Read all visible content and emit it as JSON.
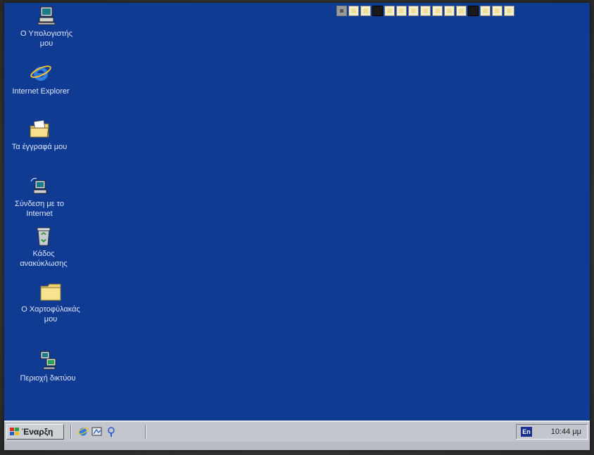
{
  "desktop": {
    "background": "#0f3b92",
    "icons": [
      {
        "label": "Ο Υπολογιστής\nμου",
        "icon": "my-computer-icon"
      },
      {
        "label": "Internet Explorer",
        "icon": "internet-explorer-icon"
      },
      {
        "label": "Τα έγγραφά μου",
        "icon": "my-documents-icon"
      },
      {
        "label": "Σύνδεση με το\nInternet",
        "icon": "connect-internet-icon"
      },
      {
        "label": "Κάδος\nανακύκλωσης",
        "icon": "recycle-bin-icon"
      },
      {
        "label": "Ο Χαρτοφύλακάς\nμου",
        "icon": "briefcase-folder-icon"
      },
      {
        "label": "Περιοχή δικτύου",
        "icon": "network-icon"
      }
    ]
  },
  "taskbar": {
    "start_label": "Έναρξη",
    "quick_launch": [
      "ie-quick-icon",
      "desktop-quick-icon",
      "channels-quick-icon"
    ],
    "language": "En",
    "clock": "10:44 μμ"
  }
}
